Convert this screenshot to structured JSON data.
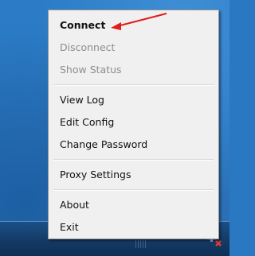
{
  "menu": {
    "items": [
      {
        "label": "Connect",
        "state": "default",
        "bold": true
      },
      {
        "label": "Disconnect",
        "state": "disabled"
      },
      {
        "label": "Show Status",
        "state": "disabled"
      },
      {
        "label": "View Log",
        "state": "enabled"
      },
      {
        "label": "Edit Config",
        "state": "enabled"
      },
      {
        "label": "Change Password",
        "state": "enabled"
      },
      {
        "label": "Proxy Settings",
        "state": "enabled"
      },
      {
        "label": "About",
        "state": "enabled"
      },
      {
        "label": "Exit",
        "state": "enabled"
      }
    ]
  },
  "annotation": {
    "arrow_color": "#e31b1b",
    "arrow_target": "Connect"
  },
  "tray": {
    "icon": "network-icon"
  },
  "colors": {
    "desktop": "#2a78c2",
    "taskbar": "#143c69",
    "menu_bg": "#f0f0f0",
    "menu_border": "#979797",
    "text": "#111111",
    "text_disabled": "#8d8d8d"
  }
}
